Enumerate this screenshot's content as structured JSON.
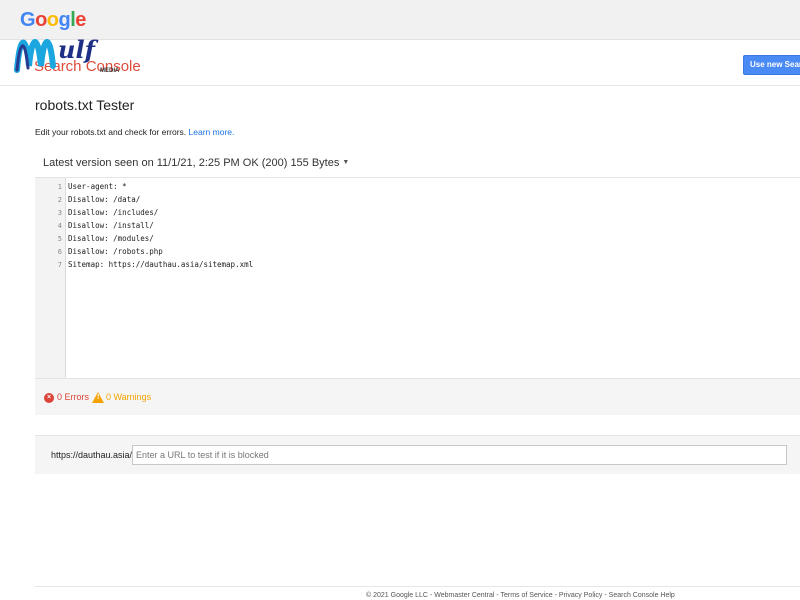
{
  "header": {
    "logo": [
      "G",
      "o",
      "o",
      "g",
      "l",
      "e"
    ],
    "product_name": "Search Console",
    "use_new_button": "Use new Search Console",
    "watermark_text": "wulf MEDIA"
  },
  "main": {
    "title": "robots.txt Tester",
    "intro_text": "Edit your robots.txt and check for errors. ",
    "learn_more": "Learn more.",
    "version_label": "Latest version seen on 11/1/21, 2:25 PM OK (200) 155 Bytes"
  },
  "editor": {
    "lines": [
      {
        "num": "1",
        "text": "User-agent: *"
      },
      {
        "num": "2",
        "text": "Disallow: /data/"
      },
      {
        "num": "3",
        "text": "Disallow: /includes/"
      },
      {
        "num": "4",
        "text": "Disallow: /install/"
      },
      {
        "num": "5",
        "text": "Disallow: /modules/"
      },
      {
        "num": "6",
        "text": "Disallow: /robots.php"
      },
      {
        "num": "7",
        "text": "Sitemap: https://dauthau.asia/sitemap.xml"
      }
    ]
  },
  "status": {
    "errors": "0 Errors",
    "warnings": "0 Warnings"
  },
  "url_test": {
    "prefix": "https://dauthau.asia/",
    "placeholder": "Enter a URL to test if it is blocked"
  },
  "footer": {
    "links": [
      "© 2021 Google LLC",
      "Webmaster Central",
      "Terms of Service",
      "Privacy Policy",
      "Search Console Help"
    ],
    "separator": " - "
  },
  "colors": {
    "accent": "#4a8af4",
    "error": "#db4437",
    "warning": "#f4a300",
    "link": "#1a73e8"
  }
}
